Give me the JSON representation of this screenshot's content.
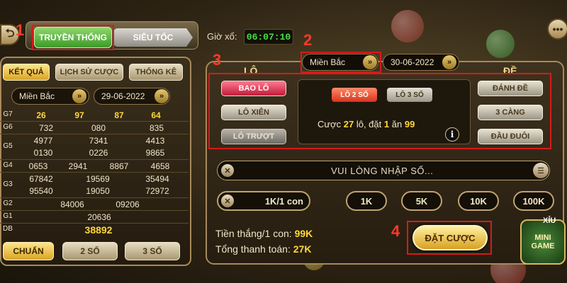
{
  "header": {
    "tab_traditional": "TRUYỀN THỐNG",
    "tab_speed": "SIÊU TỐC",
    "timer_label": "Giờ xổ:",
    "timer_value": "06:07:10"
  },
  "annotations": [
    "1",
    "2",
    "3",
    "4"
  ],
  "left": {
    "tabs": [
      "KẾT QUẢ",
      "LỊCH SỬ CƯỢC",
      "THỐNG KÊ"
    ],
    "region": "Miền Bắc",
    "date": "29-06-2022",
    "results": [
      {
        "label": "G7",
        "values": [
          "26",
          "97",
          "87",
          "64"
        ]
      },
      {
        "label": "G6",
        "values": [
          "732",
          "080",
          "835"
        ]
      },
      {
        "label": "G5",
        "values": [
          "4977",
          "7341",
          "4413",
          "0130",
          "0226",
          "9865"
        ]
      },
      {
        "label": "G4",
        "values": [
          "0653",
          "2941",
          "8867",
          "4658"
        ]
      },
      {
        "label": "G3",
        "values": [
          "67842",
          "19569",
          "35494",
          "95540",
          "19050",
          "72972"
        ]
      },
      {
        "label": "G2",
        "values": [
          "84006",
          "09206"
        ]
      },
      {
        "label": "G1",
        "values": [
          "20636"
        ]
      },
      {
        "label": "DB",
        "values": [
          "38892"
        ]
      }
    ],
    "bottom_buttons": [
      "CHUẨN",
      "2 SỐ",
      "3 SỐ"
    ]
  },
  "main": {
    "region": "Miền Bắc",
    "date": "30-06-2022",
    "lo_title": "LÔ",
    "de_title": "ĐỀ",
    "lo_buttons": [
      "BAO LÔ",
      "LÔ XIÊN",
      "LÔ TRƯỢT"
    ],
    "de_buttons": [
      "ĐÁNH ĐỀ",
      "3 CÀNG",
      "ĐẦU ĐUÔI"
    ],
    "sub_options": [
      "LÔ 2 SỐ",
      "LÔ 3 SỐ"
    ],
    "bet_info": {
      "prefix": "Cược",
      "lo_count": "27",
      "mid": "lô, đặt",
      "unit": "1",
      "mid2": "ăn",
      "payout": "99"
    },
    "number_placeholder": "VUI LÒNG NHẬP SỐ...",
    "amount_value": "1K/1 con",
    "chips": [
      "1K",
      "5K",
      "10K",
      "100K"
    ],
    "win_label": "Tiền thắng/1 con:",
    "win_value": "99K",
    "total_label": "Tổng thanh toán:",
    "total_value": "27K",
    "place_bet": "ĐẶT CƯỢC",
    "mini_game": [
      "XỈU",
      "MINI",
      "GAME"
    ]
  }
}
